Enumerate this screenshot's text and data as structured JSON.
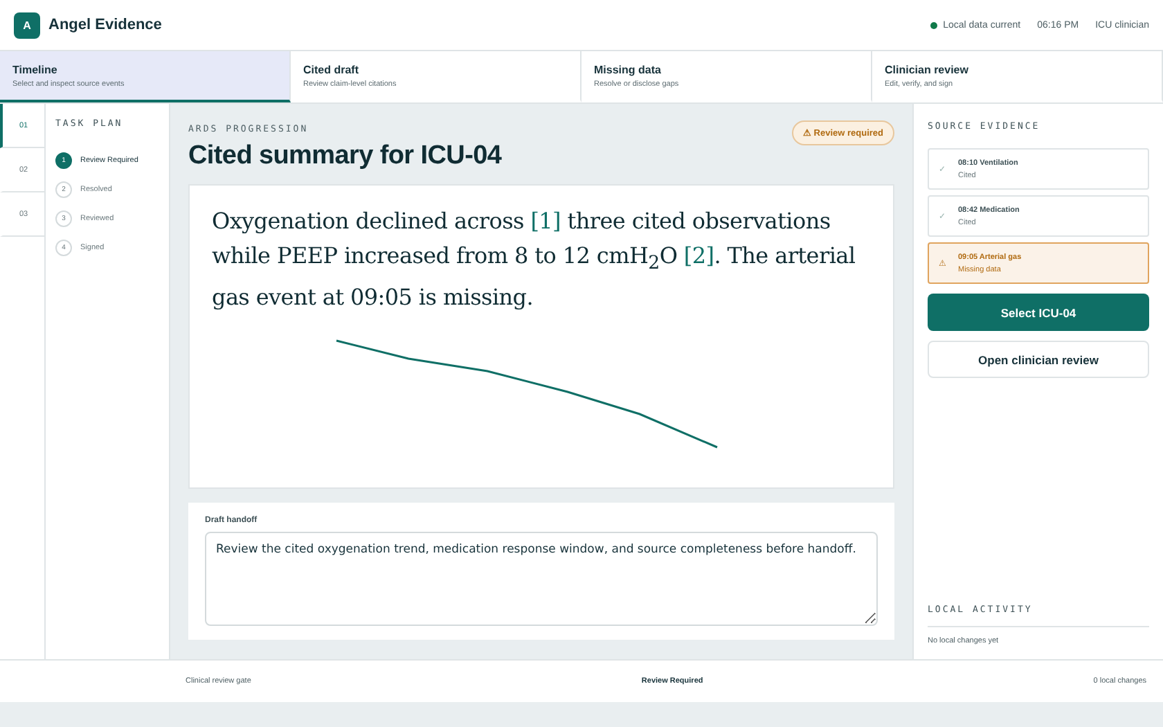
{
  "header": {
    "logo_letter": "A",
    "app_name": "Angel Evidence",
    "sync_status": "Local data current",
    "time": "06:16 PM",
    "user": "ICU clinician"
  },
  "tabs": [
    {
      "label": "Timeline",
      "subtitle": "Select and inspect source events",
      "selected": true
    },
    {
      "label": "Cited draft",
      "subtitle": "Review claim-level citations",
      "selected": false
    },
    {
      "label": "Missing data",
      "subtitle": "Resolve or disclose gaps",
      "selected": false
    },
    {
      "label": "Clinician review",
      "subtitle": "Edit, verify, and sign",
      "selected": false
    }
  ],
  "step_rail": [
    {
      "label": "01",
      "selected": true
    },
    {
      "label": "02",
      "selected": false
    },
    {
      "label": "03",
      "selected": false
    }
  ],
  "task_plan": {
    "title": "TASK PLAN",
    "steps": [
      {
        "number": "1",
        "label": "Review Required",
        "selected": true
      },
      {
        "number": "2",
        "label": "Resolved",
        "selected": false
      },
      {
        "number": "3",
        "label": "Reviewed",
        "selected": false
      },
      {
        "number": "4",
        "label": "Signed",
        "selected": false
      }
    ]
  },
  "summary": {
    "eyebrow": "ARDS PROGRESSION",
    "title": "Cited summary for ICU-04",
    "badge": "Review required",
    "badge_icon": "⚠",
    "text": [
      {
        "kind": "plain",
        "text": "Oxygenation declined across "
      },
      {
        "kind": "citation",
        "text": "[1]"
      },
      {
        "kind": "plain",
        "text": " three cited observations while PEEP increased from 8 to 12 cmH$_{2}$O "
      },
      {
        "kind": "citation",
        "text": "[2]"
      },
      {
        "kind": "plain",
        "text": ". The arterial gas event at 09:05 is missing."
      }
    ]
  },
  "handoff": {
    "label": "Draft handoff",
    "value": "Review the cited oxygenation trend, medication response window, and source completeness before handoff."
  },
  "source_evidence": {
    "title": "SOURCE EVIDENCE",
    "items": [
      {
        "kind": "cited",
        "icon": "✓",
        "title": "08:10 Ventilation",
        "status": "Cited"
      },
      {
        "kind": "cited",
        "icon": "✓",
        "title": "08:42 Medication",
        "status": "Cited"
      },
      {
        "kind": "missing",
        "icon": "⚠",
        "title": "09:05 Arterial gas",
        "status": "Missing data"
      }
    ],
    "primary_button": "Select ICU-04",
    "secondary_button": "Open clinician review"
  },
  "local_activity": {
    "title": "LOCAL ACTIVITY",
    "text": "No local changes yet"
  },
  "footer": {
    "left": "Clinical review gate",
    "center": "Review Required",
    "right": "0 local changes"
  }
}
